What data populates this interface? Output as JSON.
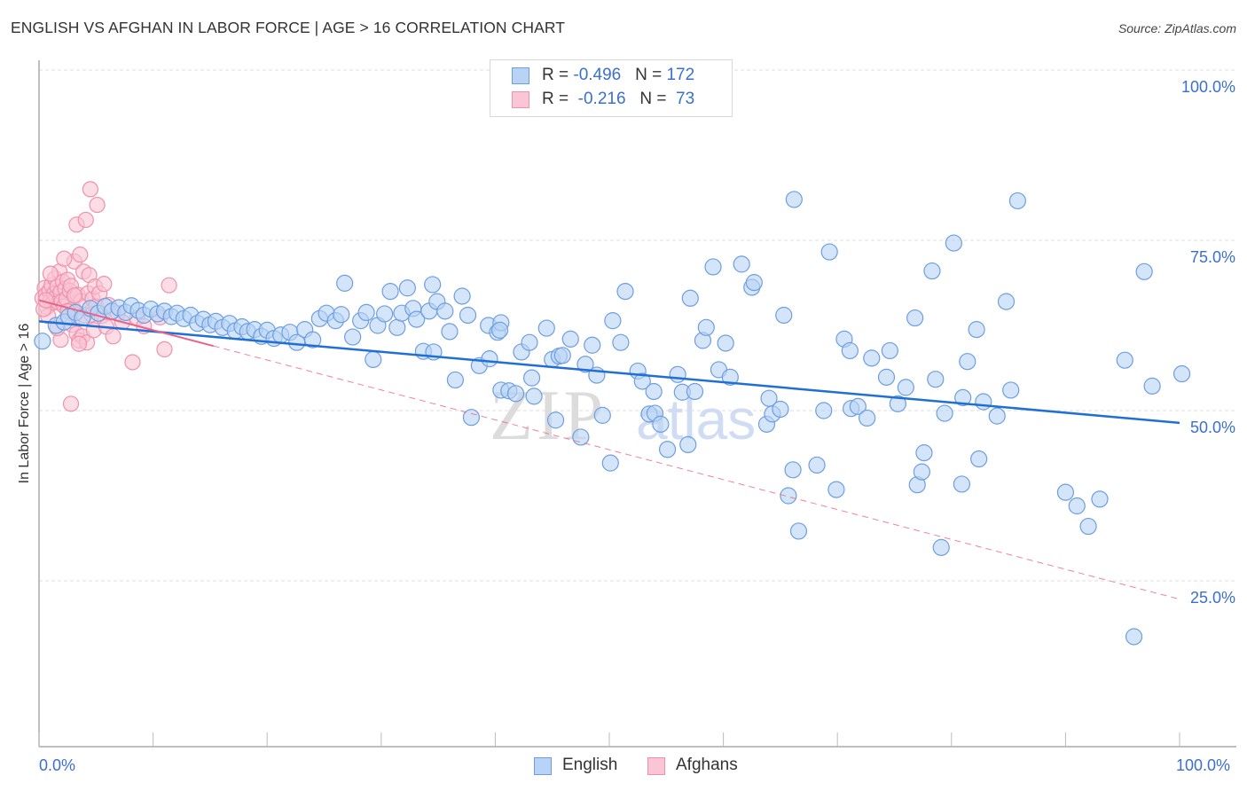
{
  "header": {
    "title": "ENGLISH VS AFGHAN IN LABOR FORCE | AGE > 16 CORRELATION CHART",
    "source": "Source: ZipAtlas.com"
  },
  "stats_legend": [
    {
      "series": "English",
      "r_label": "R = ",
      "r_value": "-0.496",
      "n_label": "N = ",
      "n_value": "172",
      "fill": "#b8d3f5",
      "stroke": "#6d9ee0"
    },
    {
      "series": "Afghans",
      "r_label": "R = ",
      "r_value": " -0.216",
      "n_label": "N = ",
      "n_value": " 73",
      "fill": "#fac5d4",
      "stroke": "#ee92ad"
    }
  ],
  "watermark": {
    "zip": "ZIP",
    "atlas": "atlas"
  },
  "chart_data": {
    "type": "scatter",
    "title": "ENGLISH VS AFGHAN IN LABOR FORCE | AGE > 16 CORRELATION CHART",
    "xlabel": "",
    "ylabel": "In Labor Force | Age > 16",
    "xlim": [
      0,
      100
    ],
    "ylim": [
      0,
      100
    ],
    "x_tick_labels": [
      "0.0%",
      "100.0%"
    ],
    "x_ticks_minor": [
      0,
      10,
      20,
      30,
      40,
      50,
      60,
      70,
      80,
      90,
      100
    ],
    "y_ticks": [
      25,
      50,
      75,
      100
    ],
    "y_tick_labels": [
      "25.0%",
      "50.0%",
      "75.0%",
      "100.0%"
    ],
    "grid": true,
    "legend": {
      "position": "bottom-center",
      "entries": [
        "English",
        "Afghans"
      ]
    },
    "series": [
      {
        "name": "English",
        "color": "#6d9ee0",
        "fill": "#b8d3f5",
        "trend": {
          "x": [
            0,
            100
          ],
          "y": [
            63.1,
            48.2
          ],
          "style": "solid",
          "color": "#1f6fd6"
        },
        "points": [
          [
            0.3,
            60.2
          ],
          [
            1.5,
            62.5
          ],
          [
            2.2,
            63.0
          ],
          [
            2.6,
            63.8
          ],
          [
            3.2,
            64.4
          ],
          [
            3.8,
            63.6
          ],
          [
            4.5,
            65.0
          ],
          [
            5.2,
            64.3
          ],
          [
            5.8,
            65.3
          ],
          [
            6.4,
            64.6
          ],
          [
            7.0,
            65.1
          ],
          [
            7.6,
            64.4
          ],
          [
            8.1,
            65.4
          ],
          [
            8.7,
            64.7
          ],
          [
            9.2,
            64.0
          ],
          [
            9.8,
            64.9
          ],
          [
            10.4,
            64.2
          ],
          [
            11.0,
            64.6
          ],
          [
            11.6,
            63.8
          ],
          [
            12.1,
            64.3
          ],
          [
            12.7,
            63.5
          ],
          [
            13.3,
            64.0
          ],
          [
            13.9,
            62.8
          ],
          [
            14.4,
            63.4
          ],
          [
            15.0,
            62.6
          ],
          [
            15.5,
            63.1
          ],
          [
            16.1,
            62.2
          ],
          [
            16.7,
            62.8
          ],
          [
            17.2,
            61.7
          ],
          [
            17.8,
            62.3
          ],
          [
            18.3,
            61.6
          ],
          [
            18.9,
            61.9
          ],
          [
            19.5,
            60.9
          ],
          [
            20.0,
            61.8
          ],
          [
            20.6,
            60.6
          ],
          [
            21.2,
            61.1
          ],
          [
            22.0,
            61.5
          ],
          [
            22.6,
            60.0
          ],
          [
            23.3,
            61.9
          ],
          [
            24.0,
            60.4
          ],
          [
            24.6,
            63.5
          ],
          [
            25.2,
            64.3
          ],
          [
            26.0,
            63.2
          ],
          [
            26.5,
            64.1
          ],
          [
            26.8,
            68.7
          ],
          [
            27.5,
            60.8
          ],
          [
            28.2,
            63.2
          ],
          [
            28.7,
            64.4
          ],
          [
            29.3,
            57.5
          ],
          [
            29.7,
            62.5
          ],
          [
            30.3,
            64.2
          ],
          [
            30.8,
            67.5
          ],
          [
            31.4,
            62.2
          ],
          [
            31.8,
            64.3
          ],
          [
            32.3,
            68.0
          ],
          [
            32.8,
            65.0
          ],
          [
            33.1,
            63.4
          ],
          [
            33.7,
            58.7
          ],
          [
            34.2,
            64.6
          ],
          [
            34.5,
            68.5
          ],
          [
            34.9,
            66.0
          ],
          [
            35.6,
            64.6
          ],
          [
            36.0,
            61.6
          ],
          [
            36.5,
            54.5
          ],
          [
            37.1,
            66.8
          ],
          [
            37.6,
            64.0
          ],
          [
            37.9,
            49.0
          ],
          [
            38.6,
            56.6
          ],
          [
            39.4,
            62.5
          ],
          [
            39.5,
            57.6
          ],
          [
            40.2,
            61.5
          ],
          [
            40.5,
            62.9
          ],
          [
            40.5,
            53.0
          ],
          [
            41.2,
            52.9
          ],
          [
            41.8,
            52.5
          ],
          [
            42.3,
            58.6
          ],
          [
            43.0,
            60.0
          ],
          [
            43.2,
            54.8
          ],
          [
            43.4,
            52.1
          ],
          [
            44.5,
            62.1
          ],
          [
            45.0,
            57.5
          ],
          [
            45.3,
            48.6
          ],
          [
            45.6,
            58.0
          ],
          [
            45.9,
            58.1
          ],
          [
            46.6,
            60.5
          ],
          [
            47.5,
            46.1
          ],
          [
            47.9,
            56.8
          ],
          [
            48.5,
            59.6
          ],
          [
            48.9,
            55.2
          ],
          [
            49.4,
            49.3
          ],
          [
            50.1,
            42.3
          ],
          [
            50.3,
            63.2
          ],
          [
            51.0,
            60.0
          ],
          [
            51.4,
            67.5
          ],
          [
            52.5,
            55.8
          ],
          [
            52.9,
            54.3
          ],
          [
            53.5,
            49.5
          ],
          [
            53.9,
            52.8
          ],
          [
            54.0,
            49.6
          ],
          [
            54.5,
            48.0
          ],
          [
            55.1,
            44.3
          ],
          [
            56.0,
            55.3
          ],
          [
            56.4,
            52.7
          ],
          [
            57.1,
            66.5
          ],
          [
            57.5,
            52.8
          ],
          [
            58.2,
            60.3
          ],
          [
            58.5,
            62.2
          ],
          [
            59.1,
            71.1
          ],
          [
            59.6,
            56.0
          ],
          [
            60.2,
            59.9
          ],
          [
            60.6,
            54.9
          ],
          [
            61.6,
            71.5
          ],
          [
            62.5,
            68.1
          ],
          [
            62.7,
            68.8
          ],
          [
            63.8,
            48.0
          ],
          [
            65.3,
            64.0
          ],
          [
            64.0,
            51.8
          ],
          [
            64.3,
            49.5
          ],
          [
            65.0,
            50.2
          ],
          [
            65.7,
            37.5
          ],
          [
            66.1,
            41.3
          ],
          [
            66.2,
            81.0
          ],
          [
            66.6,
            32.3
          ],
          [
            68.2,
            42.0
          ],
          [
            68.8,
            50.0
          ],
          [
            69.3,
            73.3
          ],
          [
            69.9,
            38.4
          ],
          [
            70.6,
            60.5
          ],
          [
            71.1,
            58.8
          ],
          [
            71.2,
            50.3
          ],
          [
            71.8,
            50.6
          ],
          [
            72.6,
            48.9
          ],
          [
            73.0,
            57.7
          ],
          [
            74.3,
            54.9
          ],
          [
            74.6,
            58.8
          ],
          [
            75.3,
            51.0
          ],
          [
            76.0,
            53.4
          ],
          [
            76.8,
            63.6
          ],
          [
            77.0,
            39.1
          ],
          [
            77.4,
            41.0
          ],
          [
            77.6,
            43.8
          ],
          [
            78.3,
            70.5
          ],
          [
            78.6,
            54.6
          ],
          [
            79.1,
            29.9
          ],
          [
            79.4,
            49.6
          ],
          [
            80.2,
            74.6
          ],
          [
            80.9,
            39.2
          ],
          [
            81.0,
            51.9
          ],
          [
            81.4,
            57.2
          ],
          [
            82.2,
            61.9
          ],
          [
            82.4,
            42.9
          ],
          [
            82.8,
            51.3
          ],
          [
            84.0,
            49.2
          ],
          [
            84.8,
            66.0
          ],
          [
            85.2,
            53.0
          ],
          [
            85.8,
            80.8
          ],
          [
            90.0,
            38.0
          ],
          [
            91.0,
            36.0
          ],
          [
            92.0,
            33.0
          ],
          [
            93.0,
            37.0
          ],
          [
            95.2,
            57.4
          ],
          [
            96.0,
            16.8
          ],
          [
            96.9,
            70.4
          ],
          [
            97.6,
            53.6
          ],
          [
            100.2,
            55.4
          ],
          [
            56.9,
            45.0
          ],
          [
            34.6,
            58.6
          ],
          [
            40.4,
            61.8
          ]
        ]
      },
      {
        "name": "Afghans",
        "color": "#ee92ad",
        "fill": "#fac5d4",
        "trend": {
          "x": [
            0,
            100
          ],
          "y": [
            66.2,
            22.3
          ],
          "style": "dashed",
          "solid_until_x": 15.3,
          "color": "#e8638a"
        },
        "points": [
          [
            0.3,
            66.5
          ],
          [
            0.5,
            68.0
          ],
          [
            0.6,
            67.0
          ],
          [
            0.7,
            65.2
          ],
          [
            0.9,
            67.6
          ],
          [
            1.0,
            66.2
          ],
          [
            1.1,
            68.4
          ],
          [
            1.2,
            65.8
          ],
          [
            1.3,
            67.1
          ],
          [
            1.4,
            69.4
          ],
          [
            1.5,
            66.7
          ],
          [
            1.6,
            68.2
          ],
          [
            1.7,
            65.9
          ],
          [
            1.8,
            70.4
          ],
          [
            1.9,
            67.4
          ],
          [
            2.0,
            66.0
          ],
          [
            2.1,
            68.9
          ],
          [
            2.2,
            65.3
          ],
          [
            2.3,
            67.9
          ],
          [
            2.4,
            66.4
          ],
          [
            2.5,
            69.2
          ],
          [
            2.6,
            64.5
          ],
          [
            2.7,
            67.6
          ],
          [
            2.8,
            68.3
          ],
          [
            2.9,
            62.6
          ],
          [
            3.0,
            65.0
          ],
          [
            3.1,
            71.9
          ],
          [
            3.2,
            66.8
          ],
          [
            3.3,
            61.3
          ],
          [
            3.3,
            77.3
          ],
          [
            3.4,
            67.0
          ],
          [
            3.5,
            60.3
          ],
          [
            3.6,
            72.9
          ],
          [
            3.7,
            66.1
          ],
          [
            3.8,
            60.9
          ],
          [
            3.9,
            70.4
          ],
          [
            4.0,
            64.0
          ],
          [
            4.1,
            78.0
          ],
          [
            4.2,
            60.0
          ],
          [
            4.3,
            67.2
          ],
          [
            4.4,
            69.9
          ],
          [
            4.5,
            82.5
          ],
          [
            4.6,
            64.1
          ],
          [
            4.7,
            66.4
          ],
          [
            4.8,
            61.8
          ],
          [
            4.9,
            68.2
          ],
          [
            5.0,
            65.3
          ],
          [
            5.1,
            80.2
          ],
          [
            5.3,
            67.2
          ],
          [
            5.5,
            63.9
          ],
          [
            5.7,
            68.6
          ],
          [
            5.9,
            62.3
          ],
          [
            6.1,
            65.5
          ],
          [
            6.5,
            60.9
          ],
          [
            6.9,
            64.3
          ],
          [
            7.3,
            63.0
          ],
          [
            8.2,
            57.1
          ],
          [
            8.6,
            63.6
          ],
          [
            9.2,
            62.4
          ],
          [
            10.6,
            63.7
          ],
          [
            11.0,
            59.0
          ],
          [
            11.4,
            68.4
          ],
          [
            2.8,
            51.0
          ],
          [
            0.8,
            63.9
          ],
          [
            1.9,
            60.4
          ],
          [
            2.5,
            64.6
          ],
          [
            3.5,
            59.8
          ],
          [
            0.4,
            64.9
          ],
          [
            1.0,
            70.1
          ],
          [
            2.2,
            72.3
          ],
          [
            1.6,
            62.1
          ],
          [
            0.6,
            66.2
          ],
          [
            3.1,
            66.9
          ]
        ]
      }
    ]
  }
}
